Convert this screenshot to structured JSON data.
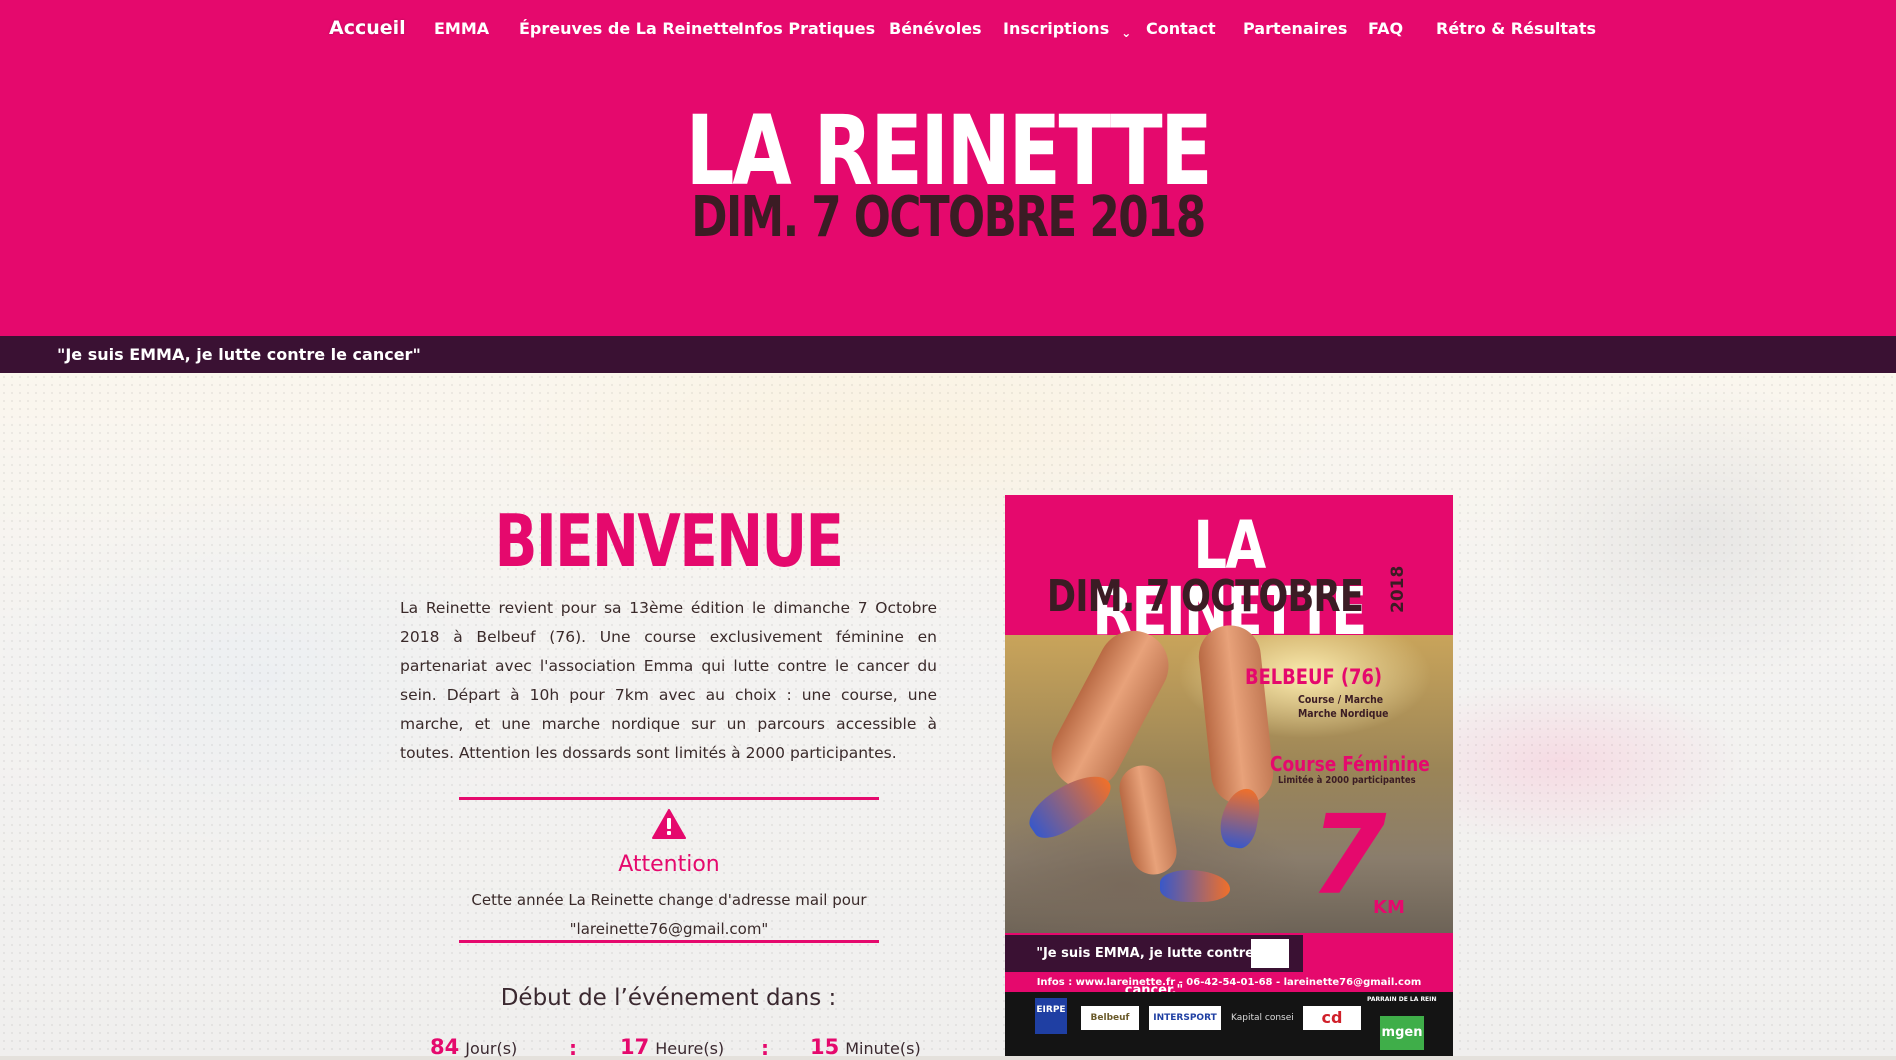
{
  "nav": {
    "items": [
      {
        "label": "Accueil",
        "active": true
      },
      {
        "label": "EMMA"
      },
      {
        "label": "Épreuves de La Reinette"
      },
      {
        "label": "Infos Pratiques"
      },
      {
        "label": "Bénévoles"
      },
      {
        "label": "Inscriptions",
        "has_dropdown": true
      },
      {
        "label": "Contact"
      },
      {
        "label": "Partenaires"
      },
      {
        "label": "FAQ"
      },
      {
        "label": "Rétro & Résultats"
      }
    ],
    "chevron_icon": "chevron-down-icon"
  },
  "hero": {
    "title": "LA REINETTE",
    "date": "DIM. 7 OCTOBRE 2018"
  },
  "tagline": "\"Je suis EMMA, je lutte contre le cancer\"",
  "welcome": {
    "title": "BIENVENUE",
    "text": "La Reinette revient pour sa 13ème édition le dimanche 7 Octobre 2018 à Belbeuf (76). Une course exclusivement féminine en partenariat avec l'association Emma qui lutte contre le cancer du sein. Départ à 10h pour 7km avec au choix : une course, une marche, et une marche nordique sur un parcours accessible à toutes. Attention les dossards sont limités à 2000 participantes."
  },
  "attention": {
    "icon": "warning-icon",
    "title": "Attention",
    "text_line1": "Cette année La Reinette change d'adresse mail pour",
    "text_line2": "\"lareinette76@gmail.com\""
  },
  "countdown": {
    "title": "Début de l’événement dans :",
    "days": {
      "value": "84",
      "unit": "Jour(s)"
    },
    "hours": {
      "value": "17",
      "unit": "Heure(s)"
    },
    "minutes": {
      "value": "15",
      "unit": "Minute(s)"
    },
    "separator": ":"
  },
  "poster": {
    "title": "LA REINETTE",
    "date": "DIM. 7 OCTOBRE",
    "year": "2018",
    "location": "BELBEUF (76)",
    "sub1": "Course / Marche",
    "sub2": "Marche Nordique",
    "course": "Course Féminine",
    "limit": "Limitée à 2000 participantes",
    "distance": "7",
    "unit": "KM",
    "slogan": "\"Je suis EMMA, je lutte contre le cancer.\"",
    "info": "Infos : www.lareinette.fr  -  06-42-54-01-68  -  lareinette76@gmail.com",
    "sponsors": [
      "EIRPE",
      "Belbeuf",
      "INTERSPORT",
      "Kapital conseil",
      "cd",
      "mgen"
    ],
    "parrain": "PARRAIN DE LA REINETTE"
  },
  "colors": {
    "brand_pink": "#e5096d",
    "dark_purple": "#3a1133",
    "text_dark": "#3a2a2a"
  }
}
